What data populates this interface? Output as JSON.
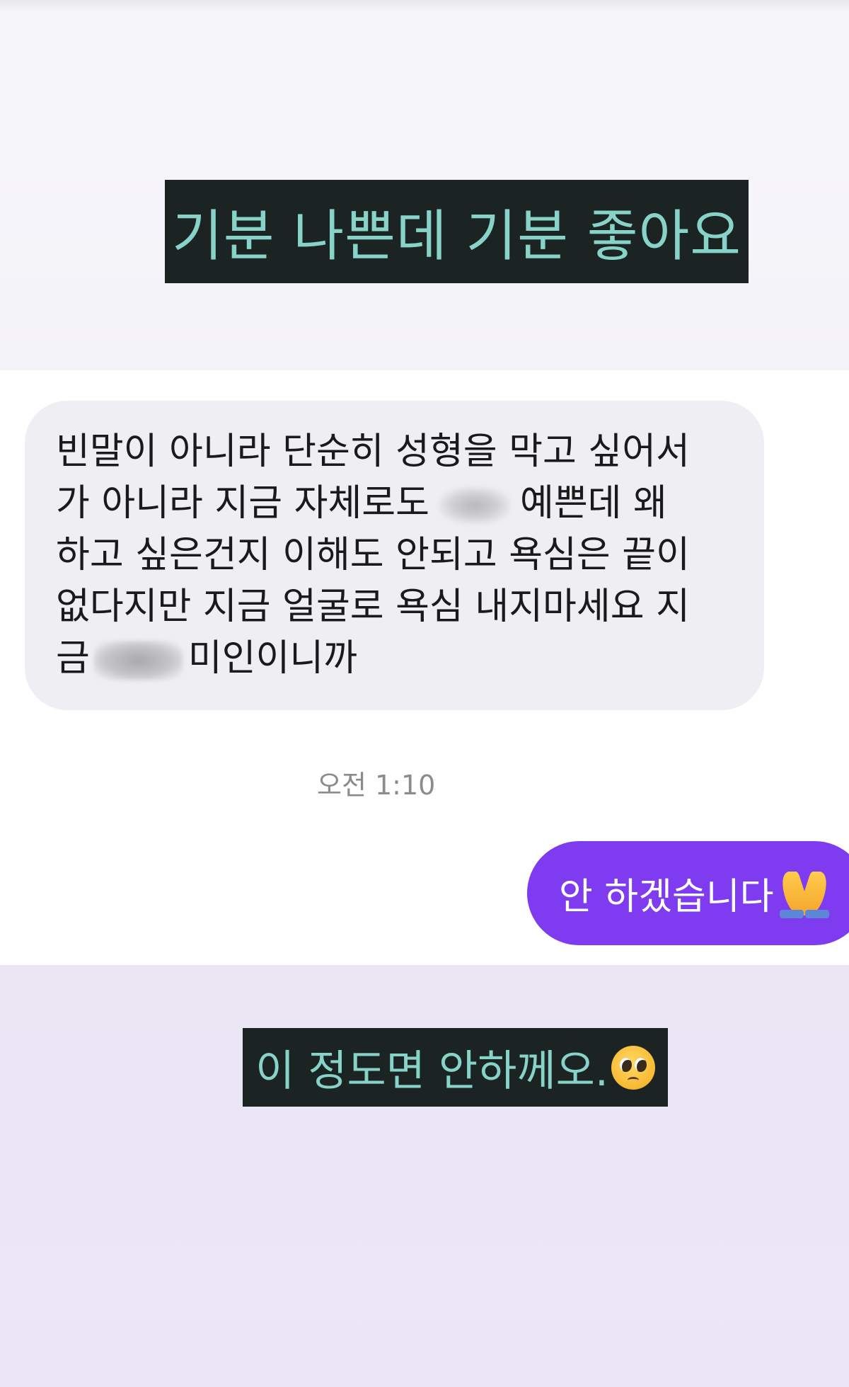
{
  "captions": {
    "top": "기분 나쁜데 기분 좋아요",
    "bottom": "이 정도면 안하께오."
  },
  "received_message": {
    "line1": "빈말이 아니라 단순히 성형을 막고 싶어서",
    "line2_before": "가 아니라 지금 자체로도",
    "line2_after": "예쁜데 왜",
    "line3": "하고 싶은건지 이해도 안되고 욕심은 끝이",
    "line4": "없다지만 지금 얼굴로 욕심 내지마세요 지",
    "line5_before": "금",
    "line5_after": "미인이니까"
  },
  "timestamp": "오전 1:10",
  "sent_message": {
    "text": "안 하겠습니다"
  },
  "icons": {
    "pray": "folded-hands-icon",
    "pleading": "pleading-face-icon"
  },
  "colors": {
    "caption_bg": "#1c2423",
    "caption_text": "#88d3c8",
    "received_bubble": "#efeff3",
    "sent_bubble": "#7e3bf0",
    "timestamp": "#8a8a8f"
  }
}
